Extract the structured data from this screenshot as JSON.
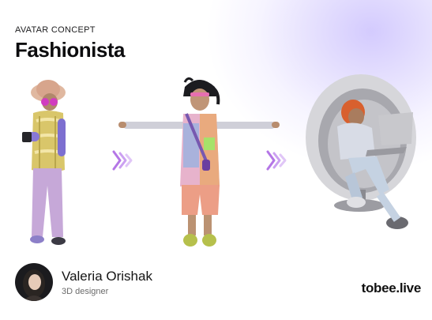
{
  "header": {
    "eyebrow": "AVATAR CONCEPT",
    "title": "Fashionista"
  },
  "figures": [
    {
      "icon": "avatar-standing-icon"
    },
    {
      "icon": "avatar-t-pose-icon"
    },
    {
      "icon": "avatar-egg-chair-laptop-icon"
    }
  ],
  "arrows": {
    "icon": "triple-chevron-right-icon",
    "color": "#b476e6"
  },
  "designer": {
    "name": "Valeria Orishak",
    "role": "3D designer"
  },
  "brand": {
    "name": "tobee.live"
  },
  "colors": {
    "accent": "#b476e6",
    "background_glow": "#b0a0fc"
  }
}
